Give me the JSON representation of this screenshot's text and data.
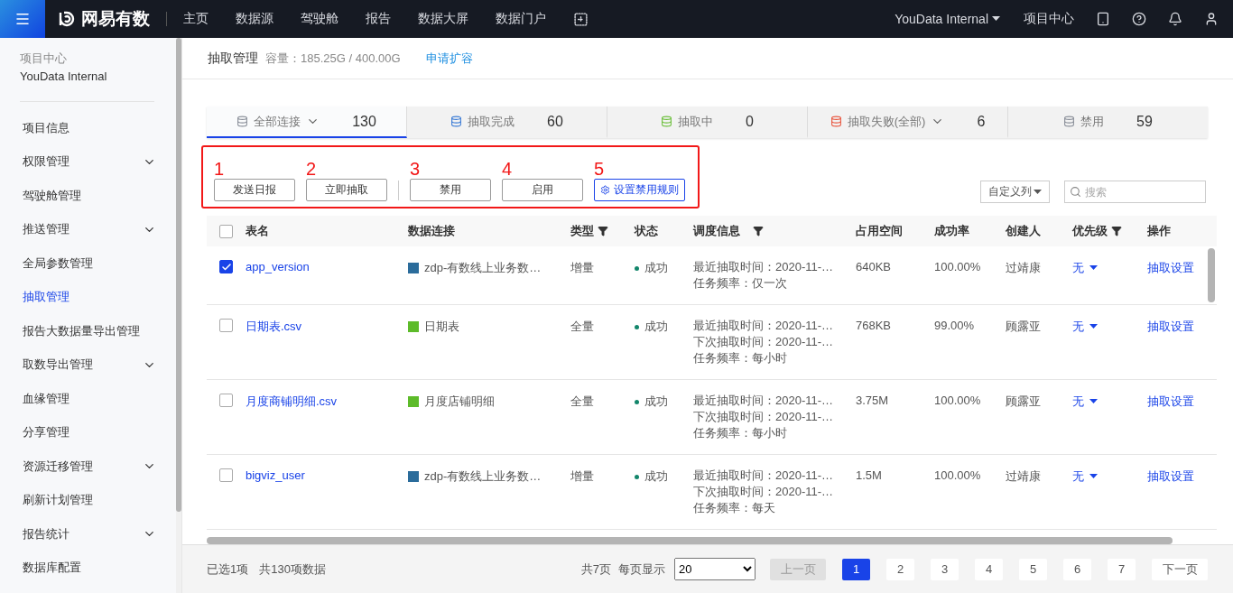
{
  "topbar": {
    "brand": "网易有数",
    "links": [
      {
        "label": "主页",
        "selected": false
      },
      {
        "label": "数据源",
        "selected": false
      },
      {
        "label": "驾驶舱",
        "selected": false
      },
      {
        "label": "报告",
        "selected": false
      },
      {
        "label": "数据大屏",
        "selected": false
      },
      {
        "label": "数据门户",
        "selected": false
      }
    ],
    "project": "YouData Internal",
    "project_center": "项目中心"
  },
  "sidebar": {
    "caption": "项目中心",
    "project": "YouData Internal",
    "items": [
      {
        "label": "项目信息",
        "expandable": false,
        "selected": false
      },
      {
        "label": "权限管理",
        "expandable": true,
        "selected": false
      },
      {
        "label": "驾驶舱管理",
        "expandable": false,
        "selected": false
      },
      {
        "label": "推送管理",
        "expandable": true,
        "selected": false
      },
      {
        "label": "全局参数管理",
        "expandable": false,
        "selected": false
      },
      {
        "label": "抽取管理",
        "expandable": false,
        "selected": true
      },
      {
        "label": "报告大数据量导出管理",
        "expandable": false,
        "selected": false
      },
      {
        "label": "取数导出管理",
        "expandable": true,
        "selected": false
      },
      {
        "label": "血缘管理",
        "expandable": false,
        "selected": false
      },
      {
        "label": "分享管理",
        "expandable": false,
        "selected": false
      },
      {
        "label": "资源迁移管理",
        "expandable": true,
        "selected": false
      },
      {
        "label": "刷新计划管理",
        "expandable": false,
        "selected": false
      },
      {
        "label": "报告统计",
        "expandable": true,
        "selected": false
      },
      {
        "label": "数据库配置",
        "expandable": false,
        "selected": false
      }
    ]
  },
  "header": {
    "title": "抽取管理",
    "capacity": "容量：185.25G / 400.00G",
    "link": "申请扩容"
  },
  "stats": [
    {
      "label": "全部连接",
      "count": "130",
      "dropdown": true,
      "selected": true,
      "color": "#8a8f99"
    },
    {
      "label": "抽取完成",
      "count": "60",
      "dropdown": false,
      "selected": false,
      "color": "#3a7bd5"
    },
    {
      "label": "抽取中",
      "count": "0",
      "dropdown": false,
      "selected": false,
      "color": "#6cbf3c"
    },
    {
      "label": "抽取失败(全部)",
      "count": "6",
      "dropdown": true,
      "selected": false,
      "color": "#e8563f"
    },
    {
      "label": "禁用",
      "count": "59",
      "dropdown": false,
      "selected": false,
      "color": "#8a8f99"
    }
  ],
  "toolbar": {
    "buttons": [
      {
        "label": "发送日报",
        "marker": "1",
        "kind": "plain"
      },
      {
        "label": "立即抽取",
        "marker": "2",
        "kind": "plain"
      },
      {
        "label": "禁用",
        "marker": "3",
        "kind": "plain"
      },
      {
        "label": "启用",
        "marker": "4",
        "kind": "plain"
      },
      {
        "label": "设置禁用规则",
        "marker": "5",
        "kind": "primary"
      }
    ],
    "columns_button": "自定义列",
    "search": {
      "placeholder": "搜索"
    }
  },
  "table": {
    "select_all": {
      "checked": false
    },
    "columns": [
      {
        "label": "表名",
        "filter": false
      },
      {
        "label": "数据连接",
        "filter": false
      },
      {
        "label": "类型",
        "filter": true
      },
      {
        "label": "状态",
        "filter": false
      },
      {
        "label": "调度信息",
        "filter": true
      },
      {
        "label": "占用空间",
        "filter": false
      },
      {
        "label": "成功率",
        "filter": false
      },
      {
        "label": "创建人",
        "filter": false
      },
      {
        "label": "优先级",
        "filter": true
      },
      {
        "label": "操作",
        "filter": false
      }
    ],
    "rows": [
      {
        "checked": true,
        "name": "app_version",
        "source": {
          "kind": "db",
          "name": "zdp-有数线上业务数…"
        },
        "type": "增量",
        "status": {
          "label": "成功",
          "color": "#13866b"
        },
        "schedule": [
          "最近抽取时间：2020-11-…",
          "任务频率：仅一次"
        ],
        "space": "640KB",
        "rate": "100.00%",
        "creator": "过靖康",
        "priority": "无",
        "action": "抽取设置"
      },
      {
        "checked": false,
        "name": "日期表.csv",
        "source": {
          "kind": "csv",
          "name": "日期表"
        },
        "type": "全量",
        "status": {
          "label": "成功",
          "color": "#13866b"
        },
        "schedule": [
          "最近抽取时间：2020-11-…",
          "下次抽取时间：2020-11-…",
          "任务频率：每小时"
        ],
        "space": "768KB",
        "rate": "99.00%",
        "creator": "顾露亚",
        "priority": "无",
        "action": "抽取设置"
      },
      {
        "checked": false,
        "name": "月度商铺明细.csv",
        "source": {
          "kind": "csv",
          "name": "月度店铺明细"
        },
        "type": "全量",
        "status": {
          "label": "成功",
          "color": "#13866b"
        },
        "schedule": [
          "最近抽取时间：2020-11-…",
          "下次抽取时间：2020-11-…",
          "任务频率：每小时"
        ],
        "space": "3.75M",
        "rate": "100.00%",
        "creator": "顾露亚",
        "priority": "无",
        "action": "抽取设置"
      },
      {
        "checked": false,
        "name": "bigviz_user",
        "source": {
          "kind": "db",
          "name": "zdp-有数线上业务数…"
        },
        "type": "增量",
        "status": {
          "label": "成功",
          "color": "#13866b"
        },
        "schedule": [
          "最近抽取时间：2020-11-…",
          "下次抽取时间：2020-11-…",
          "任务频率：每天"
        ],
        "space": "1.5M",
        "rate": "100.00%",
        "creator": "过靖康",
        "priority": "无",
        "action": "抽取设置"
      }
    ]
  },
  "footer": {
    "selected": "已选1项",
    "total": "共130项数据",
    "pages_total": "共7页",
    "per_page_label": "每页显示",
    "per_page": "20",
    "prev": {
      "label": "上一页",
      "disabled": true
    },
    "pages": [
      {
        "label": "1",
        "selected": true
      },
      {
        "label": "2",
        "selected": false
      },
      {
        "label": "3",
        "selected": false
      },
      {
        "label": "4",
        "selected": false
      },
      {
        "label": "5",
        "selected": false
      },
      {
        "label": "6",
        "selected": false
      },
      {
        "label": "7",
        "selected": false
      }
    ],
    "next": {
      "label": "下一页",
      "disabled": false
    }
  }
}
